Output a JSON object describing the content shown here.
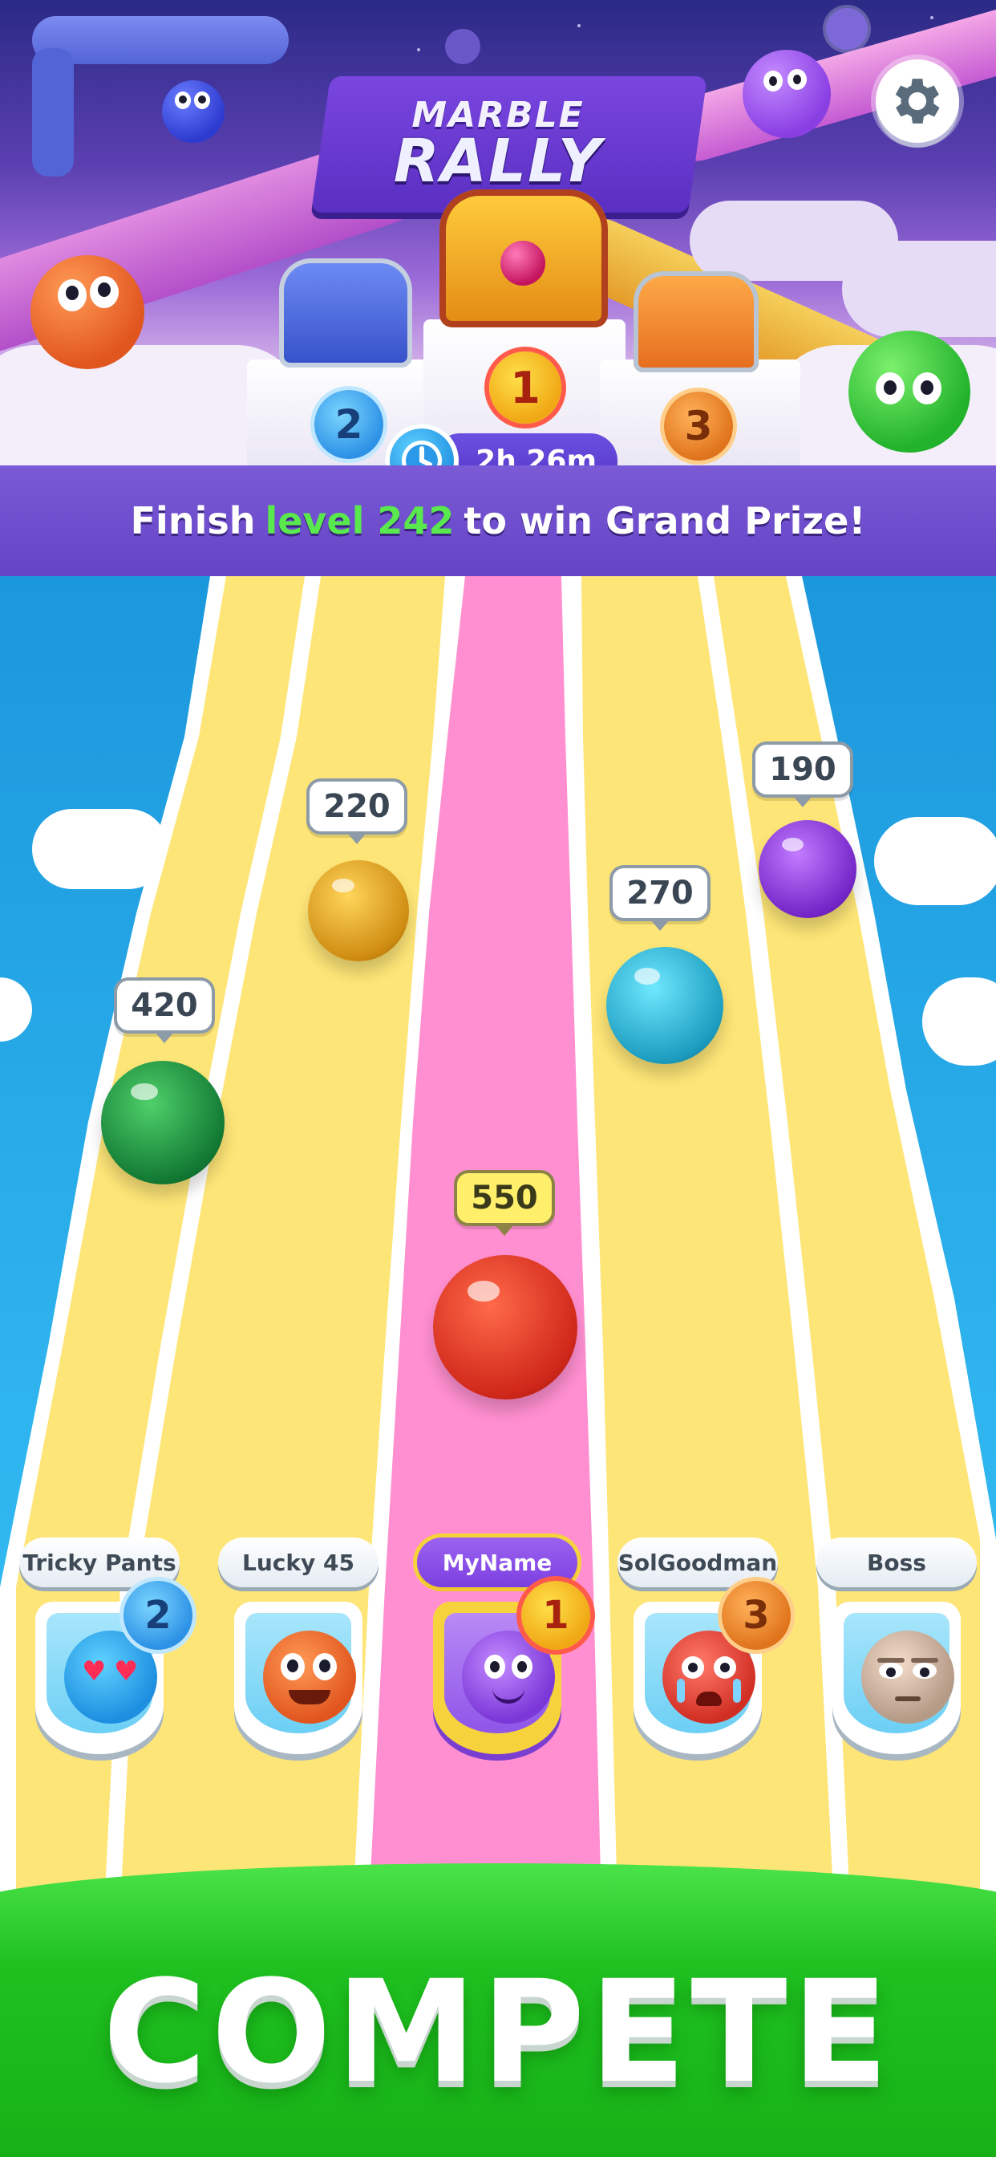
{
  "header": {
    "logo_line1": "MARBLE",
    "logo_line2": "RALLY",
    "timer": "2h 26m",
    "podium_ranks": [
      "2",
      "1",
      "3"
    ]
  },
  "goal": {
    "prefix": "Finish",
    "level_text": "level 242",
    "suffix": "to win Grand Prize!"
  },
  "race": {
    "marbles": [
      {
        "score": "420",
        "color": "green"
      },
      {
        "score": "220",
        "color": "gold"
      },
      {
        "score": "550",
        "color": "red",
        "is_player": true
      },
      {
        "score": "270",
        "color": "cyan"
      },
      {
        "score": "190",
        "color": "purple"
      }
    ],
    "players": [
      {
        "name": "Tricky Pants",
        "rank": "2",
        "avatar": "blue-heart-eyes-face"
      },
      {
        "name": "Lucky 45",
        "rank": "",
        "avatar": "orange-grin-face"
      },
      {
        "name": "MyName",
        "rank": "1",
        "avatar": "purple-smile-face",
        "is_player": true
      },
      {
        "name": "SolGoodman",
        "rank": "3",
        "avatar": "red-crying-face"
      },
      {
        "name": "Boss",
        "rank": "",
        "avatar": "beige-annoyed-face"
      }
    ]
  },
  "cta": {
    "label": "COMPETE"
  },
  "colors": {
    "goal_highlight": "#59e84d",
    "player_lane": "#ff8fd0",
    "lane": "#fde577",
    "cta": "#1fc11f"
  }
}
